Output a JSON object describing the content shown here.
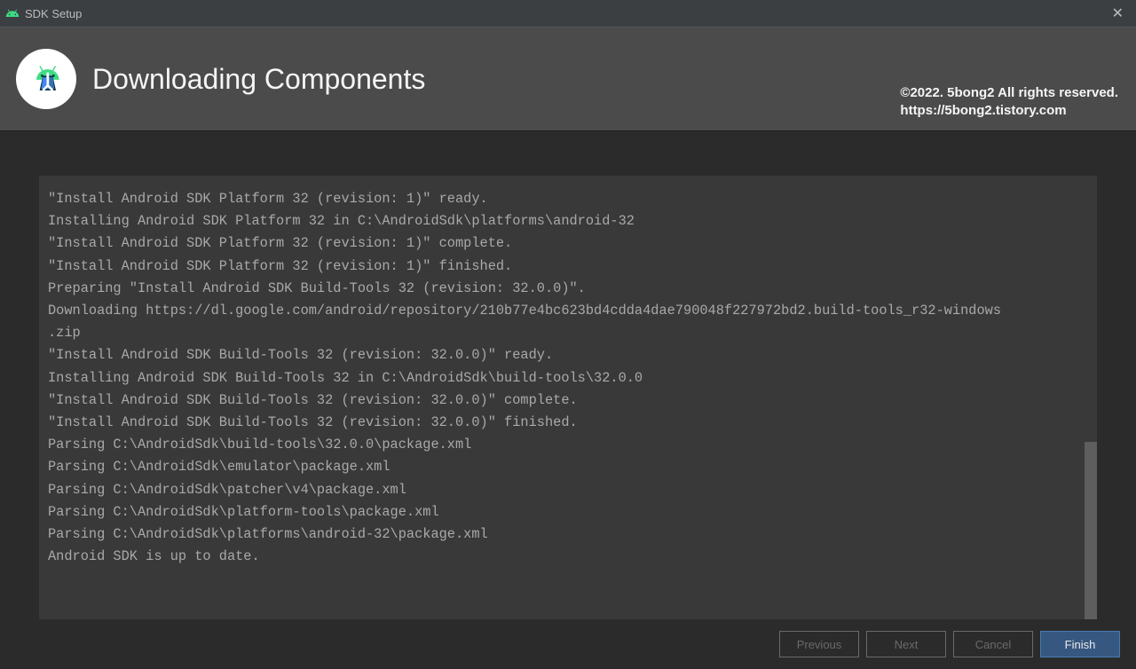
{
  "titlebar": {
    "title": "SDK Setup"
  },
  "header": {
    "title": "Downloading Components"
  },
  "watermark": {
    "line1": "©2022. 5bong2 All rights reserved.",
    "line2": "https://5bong2.tistory.com"
  },
  "log": {
    "lines": [
      "\"Install Android SDK Platform 32 (revision: 1)\" ready.",
      "Installing Android SDK Platform 32 in C:\\AndroidSdk\\platforms\\android-32",
      "\"Install Android SDK Platform 32 (revision: 1)\" complete.",
      "\"Install Android SDK Platform 32 (revision: 1)\" finished.",
      "Preparing \"Install Android SDK Build-Tools 32 (revision: 32.0.0)\".",
      "Downloading https://dl.google.com/android/repository/210b77e4bc623bd4cdda4dae790048f227972bd2.build-tools_r32-windows",
      ".zip",
      "\"Install Android SDK Build-Tools 32 (revision: 32.0.0)\" ready.",
      "Installing Android SDK Build-Tools 32 in C:\\AndroidSdk\\build-tools\\32.0.0",
      "\"Install Android SDK Build-Tools 32 (revision: 32.0.0)\" complete.",
      "\"Install Android SDK Build-Tools 32 (revision: 32.0.0)\" finished.",
      "Parsing C:\\AndroidSdk\\build-tools\\32.0.0\\package.xml",
      "Parsing C:\\AndroidSdk\\emulator\\package.xml",
      "Parsing C:\\AndroidSdk\\patcher\\v4\\package.xml",
      "Parsing C:\\AndroidSdk\\platform-tools\\package.xml",
      "Parsing C:\\AndroidSdk\\platforms\\android-32\\package.xml",
      "Android SDK is up to date."
    ]
  },
  "footer": {
    "previous": "Previous",
    "next": "Next",
    "cancel": "Cancel",
    "finish": "Finish"
  }
}
